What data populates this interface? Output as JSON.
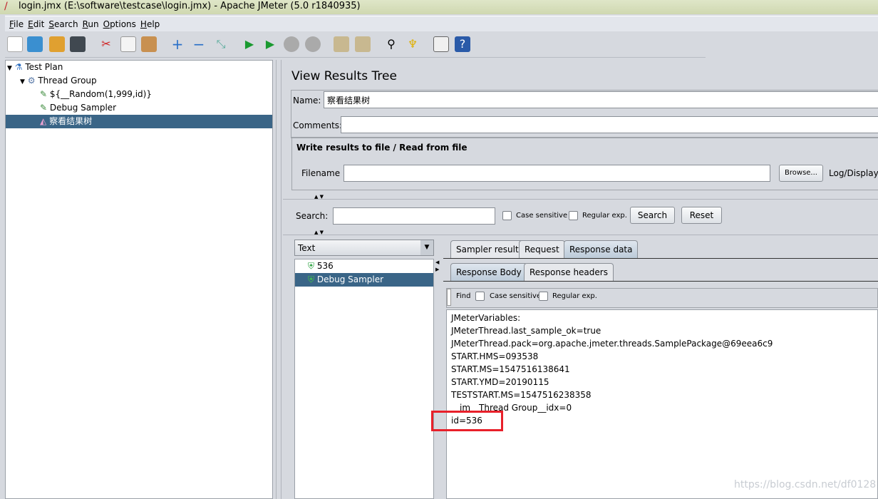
{
  "window": {
    "title": "login.jmx (E:\\software\\testcase\\login.jmx) - Apache JMeter (5.0 r1840935)"
  },
  "menu": [
    "File",
    "Edit",
    "Search",
    "Run",
    "Options",
    "Help"
  ],
  "toolbar": [
    "new-icon",
    "templates-icon",
    "open-icon",
    "save-icon",
    "cut-icon",
    "copy-icon",
    "paste-icon",
    "expand-icon",
    "collapse-icon",
    "toggle-icon",
    "start-icon",
    "start-no-pause-icon",
    "stop-icon",
    "shutdown-icon",
    "clear-icon",
    "clear-all-icon",
    "search-icon",
    "reset-search-icon",
    "function-helper-icon",
    "help-icon"
  ],
  "tree": [
    {
      "label": "Test Plan",
      "icon": "flask-icon"
    },
    {
      "label": "Thread Group",
      "icon": "gear-icon"
    },
    {
      "label": "${__Random(1,999,id)}",
      "icon": "dropper-icon"
    },
    {
      "label": "Debug Sampler",
      "icon": "dropper-icon"
    },
    {
      "label": "察看结果树",
      "icon": "chart-icon",
      "selected": true
    }
  ],
  "panel": {
    "title": "View Results Tree",
    "name_label": "Name:",
    "name_value": "察看结果树",
    "comments_label": "Comments:",
    "comments_value": "",
    "file_section": "Write results to file / Read from file",
    "filename_label": "Filename",
    "filename_value": "",
    "browse": "Browse...",
    "log_display": "Log/Display",
    "search_label": "Search:",
    "search_value": "",
    "case_sensitive": "Case sensitive",
    "regular_exp": "Regular exp.",
    "search_btn": "Search",
    "reset_btn": "Reset",
    "renderer": "Text",
    "results": [
      {
        "label": "536"
      },
      {
        "label": "Debug Sampler",
        "selected": true
      }
    ],
    "tabs": [
      "Sampler result",
      "Request",
      "Response data"
    ],
    "subtabs": [
      "Response Body",
      "Response headers"
    ],
    "find": "Find",
    "response_lines": [
      "JMeterVariables:",
      "JMeterThread.last_sample_ok=true",
      "JMeterThread.pack=org.apache.jmeter.threads.SamplePackage@69eea6c9",
      "START.HMS=093538",
      "START.MS=1547516138641",
      "START.YMD=20190115",
      "TESTSTART.MS=1547516238358",
      "__jm__Thread Group__idx=0",
      "id=536"
    ]
  },
  "watermark": "https://blog.csdn.net/df0128",
  "colors": {
    "selection": "#3a6587",
    "highlight_box": "#e8202a"
  }
}
